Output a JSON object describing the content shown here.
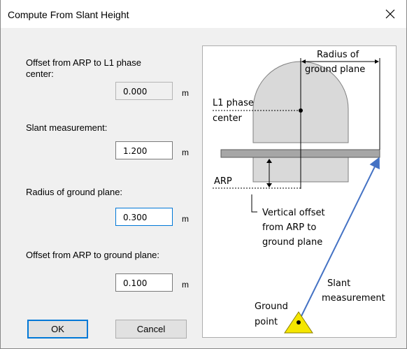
{
  "window": {
    "title": "Compute From Slant Height",
    "close_glyph": "✕"
  },
  "form": {
    "offset_l1": {
      "label": "Offset from ARP to L1 phase center:",
      "value": "0.000",
      "unit": "m"
    },
    "slant": {
      "label": "Slant measurement:",
      "value": "1.200",
      "unit": "m"
    },
    "radius": {
      "label": "Radius of ground plane:",
      "value": "0.300",
      "unit": "m"
    },
    "offset_gp": {
      "label": "Offset from ARP to ground plane:",
      "value": "0.100",
      "unit": "m"
    }
  },
  "buttons": {
    "ok": "OK",
    "cancel": "Cancel"
  },
  "diagram": {
    "radius_line1": "Radius of",
    "radius_line2": "ground plane",
    "l1_line1": "L1 phase",
    "l1_line2": "center",
    "arp": "ARP",
    "vert_line1": "Vertical offset",
    "vert_line2": "from ARP to",
    "vert_line3": "ground plane",
    "slant_line1": "Slant",
    "slant_line2": "measurement",
    "ground_line1": "Ground",
    "ground_line2": "point",
    "colors": {
      "arrow": "#4472c4",
      "ground_marker": "#f5e600",
      "antenna": "#d9d9d9",
      "plane": "#a6a6a6"
    }
  }
}
